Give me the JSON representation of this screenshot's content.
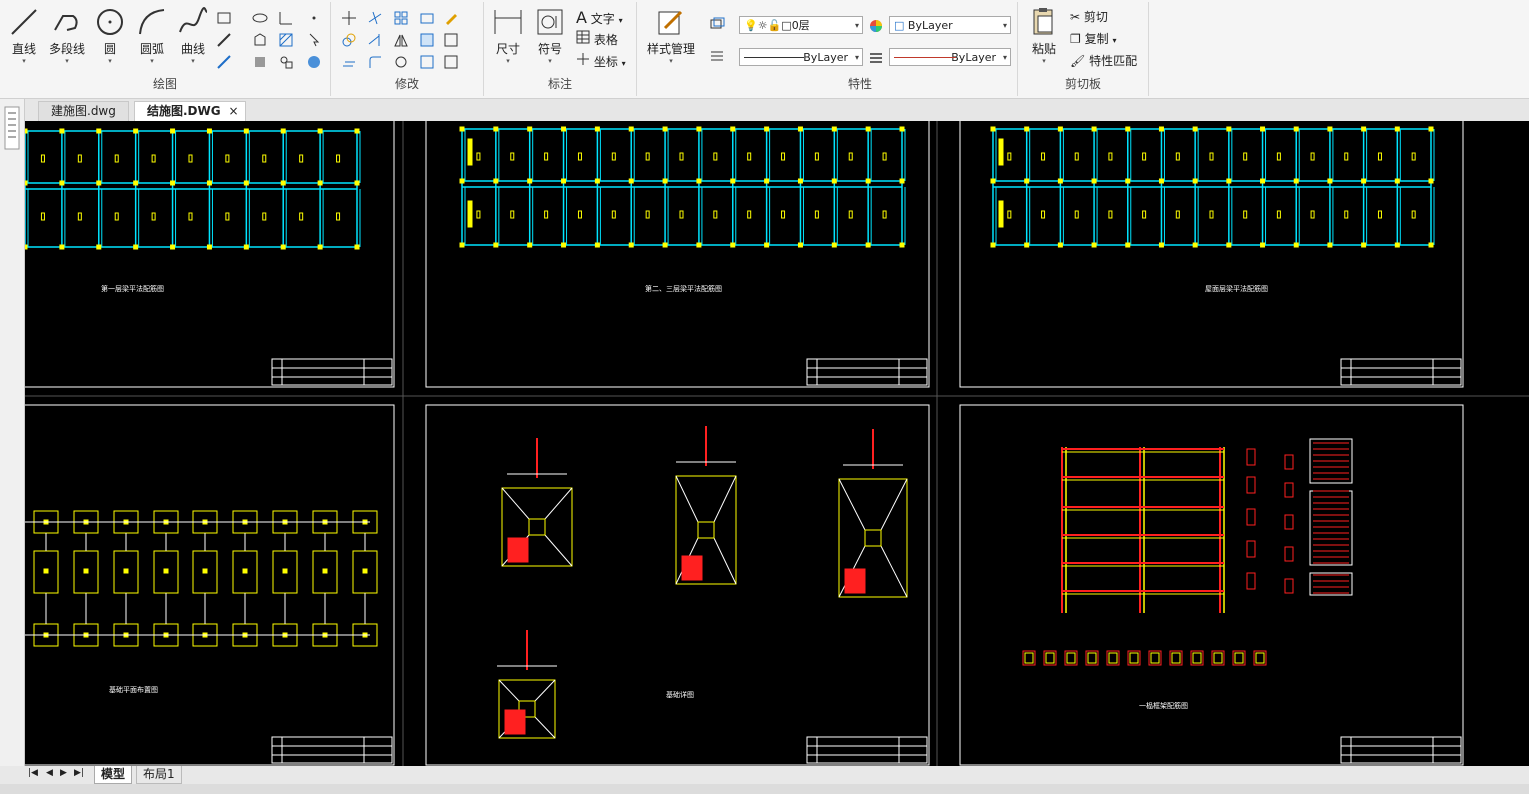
{
  "ribbon": {
    "draw": {
      "title": "绘图",
      "line": "直线",
      "polyline": "多段线",
      "circle": "圆",
      "arc": "圆弧",
      "curve": "曲线"
    },
    "modify": {
      "title": "修改"
    },
    "annotate": {
      "title": "标注",
      "dimension": "尺寸",
      "symbol": "符号",
      "text": "文字",
      "table": "表格",
      "coordinate": "坐标"
    },
    "style": {
      "label": "样式管理"
    },
    "properties": {
      "title": "特性",
      "layer": "0层",
      "color": "ByLayer",
      "linetype": "ByLayer",
      "lineweight": "ByLayer"
    },
    "clipboard": {
      "title": "剪切板",
      "paste": "粘贴",
      "cut": "剪切",
      "copy": "复制",
      "match": "特性匹配"
    }
  },
  "tabs": [
    {
      "label": "建施图.dwg"
    },
    {
      "label": "结施图.DWG"
    }
  ],
  "bottom_tabs": {
    "model": "模型",
    "layout": "布局1"
  },
  "sheets": [
    {
      "caption": "第一层梁平法配筋图"
    },
    {
      "caption": "第二、三层梁平法配筋图"
    },
    {
      "caption": "屋面层梁平法配筋图"
    },
    {
      "caption": "基础平面布置图"
    },
    {
      "caption": "基础详图"
    },
    {
      "caption": "一榀框架配筋图"
    }
  ],
  "colors": {
    "canvas": "#000000",
    "frame": "#ffffff",
    "beam": "#00e5ff",
    "footing": "#ffff00",
    "rebar": "#ff2020",
    "accent": "#1e6ec8"
  }
}
